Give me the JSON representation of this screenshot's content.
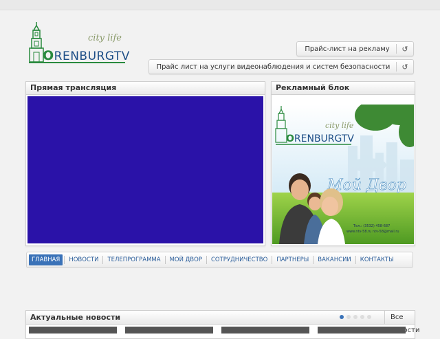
{
  "logo": {
    "tagline": "city life",
    "brand_rest": "RENBURGTV",
    "brand_first": "O"
  },
  "buttons": {
    "price_ads": "Прайс-лист на рекламу",
    "price_video": "Прайс лист на услуги видеонаблюдения и систем безопасности",
    "icon": "↺"
  },
  "panels": {
    "live_title": "Прямая трансляция",
    "ad_title": "Рекламный блок"
  },
  "ad": {
    "tagline": "city life",
    "brand_first": "O",
    "brand_rest": "RENBURGTV",
    "headline": "Мой Двор",
    "contact1": "Тел.: (3532) 458-687",
    "contact2": "www.ntv-58.ru  ntv-58@mail.ru"
  },
  "nav": {
    "items": [
      "ГЛАВНАЯ",
      "НОВОСТИ",
      "ТЕЛЕПРОГРАММА",
      "МОЙ ДВОР",
      "СОТРУДНИЧЕСТВО",
      "ПАРТНЕРЫ",
      "ВАКАНСИИ",
      "КОНТАКТЫ"
    ]
  },
  "news": {
    "title": "Актуальные новости",
    "all_link": "Все новости"
  },
  "colors": {
    "video_bg": "#2a12a8",
    "nav_active": "#3a72b8",
    "brand_green": "#2a8a3e",
    "brand_blue": "#1c4d86"
  }
}
